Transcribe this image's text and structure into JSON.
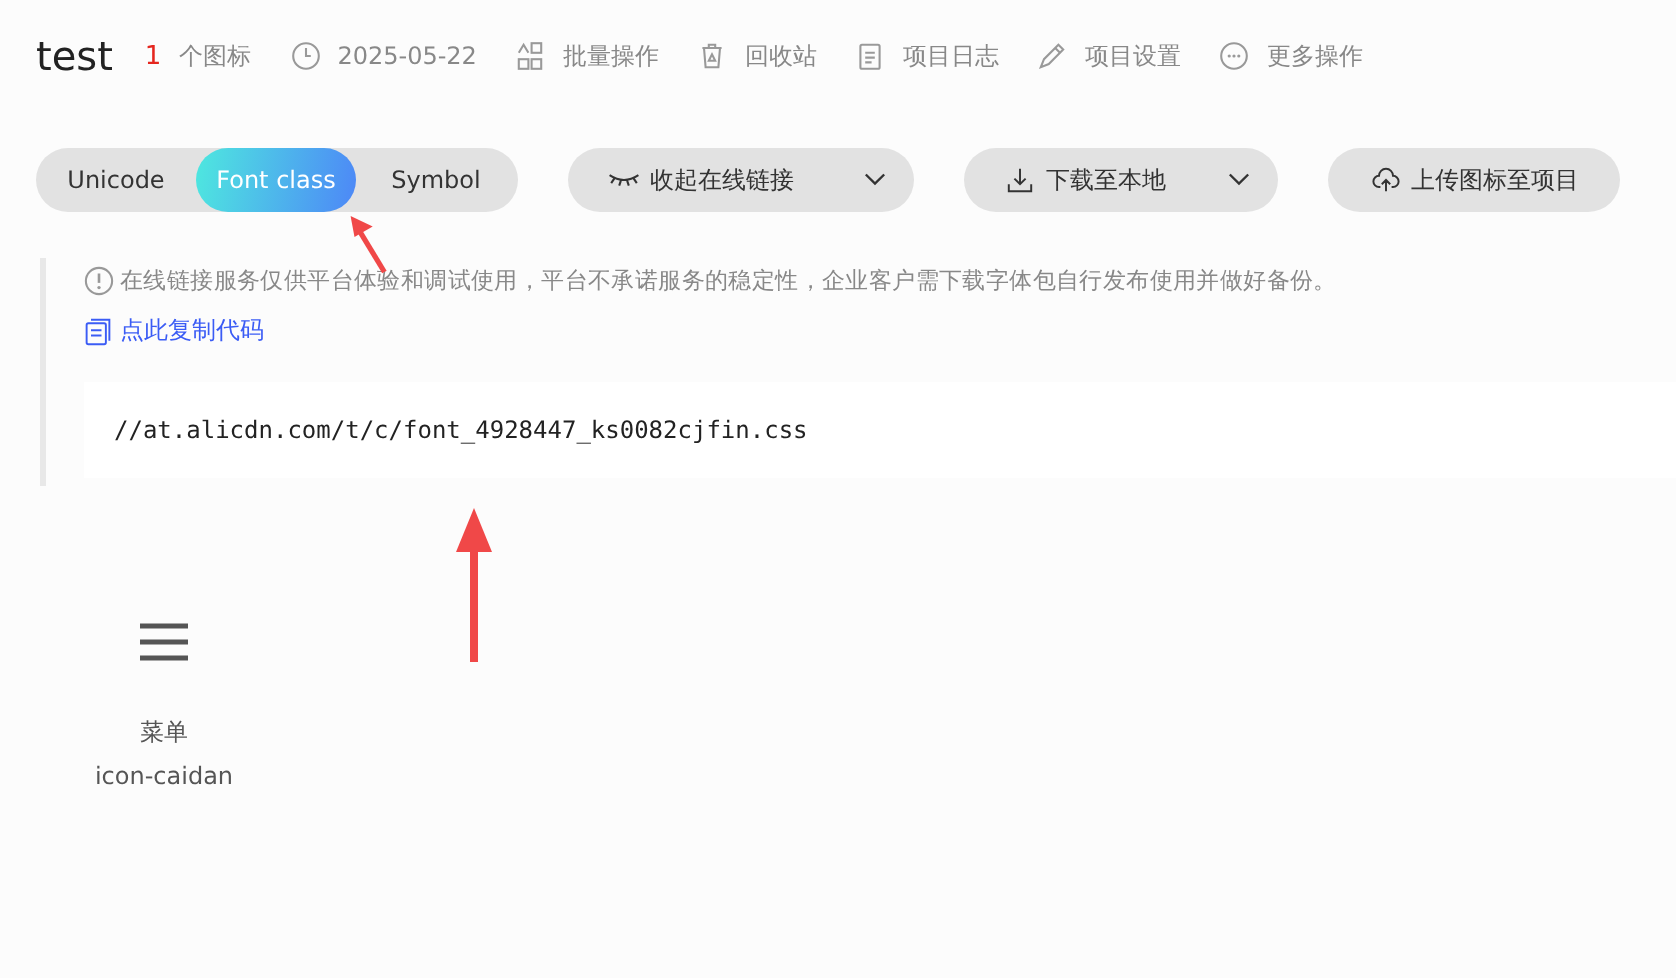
{
  "project": {
    "title": "test",
    "icon_count": "1",
    "icon_count_label": "个图标"
  },
  "toolbar": [
    {
      "kind": "date",
      "label": "2025-05-22"
    },
    {
      "kind": "batch",
      "label": "批量操作"
    },
    {
      "kind": "trash",
      "label": "回收站"
    },
    {
      "kind": "log",
      "label": "项目日志"
    },
    {
      "kind": "settings",
      "label": "项目设置"
    },
    {
      "kind": "more",
      "label": "更多操作"
    }
  ],
  "tabs": [
    {
      "label": "Unicode",
      "selected": false
    },
    {
      "label": "Font class",
      "selected": true
    },
    {
      "label": "Symbol",
      "selected": false
    }
  ],
  "actions": [
    {
      "kind": "collapse",
      "label": "收起在线链接",
      "dropdown": true
    },
    {
      "kind": "download",
      "label": "下载至本地",
      "dropdown": true
    },
    {
      "kind": "upload",
      "label": "上传图标至项目",
      "dropdown": false
    }
  ],
  "notice": {
    "text": "在线链接服务仅供平台体验和调试使用，平台不承诺服务的稳定性，企业客户需下载字体包自行发布使用并做好备份。",
    "copy_link": "点此复制代码",
    "code": "//at.alicdn.com/t/c/font_4928447_ks0082cjfin.css"
  },
  "icons": [
    {
      "name": "菜单",
      "class_name": "icon-caidan"
    }
  ]
}
